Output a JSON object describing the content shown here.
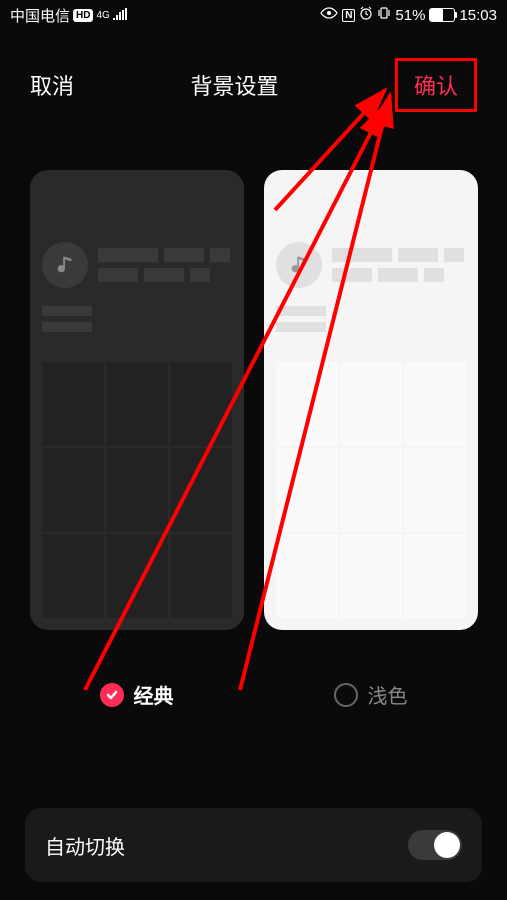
{
  "status_bar": {
    "carrier": "中国电信",
    "hd_badge": "HD",
    "network": "4G",
    "battery_pct": "51%",
    "time": "15:03"
  },
  "header": {
    "cancel": "取消",
    "title": "背景设置",
    "confirm": "确认"
  },
  "themes": {
    "classic_label": "经典",
    "light_label": "浅色"
  },
  "auto_switch": {
    "label": "自动切换"
  },
  "icons": {
    "music_note": "♪"
  }
}
